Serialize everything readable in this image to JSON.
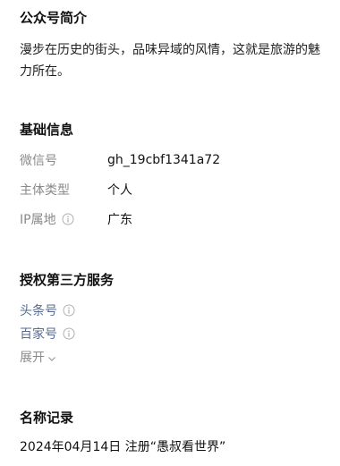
{
  "intro": {
    "title": "公众号简介",
    "description": "漫步在历史的街头，品味异域的风情，这就是旅游的魅力所在。"
  },
  "basic_info": {
    "title": "基础信息",
    "rows": [
      {
        "label": "微信号",
        "value": "gh_19cbf1341a72"
      },
      {
        "label": "主体类型",
        "value": "个人"
      },
      {
        "label": "IP属地",
        "value": "广东"
      }
    ]
  },
  "auth_services": {
    "title": "授权第三方服务",
    "items": [
      {
        "label": "头条号"
      },
      {
        "label": "百家号"
      }
    ],
    "expand_label": "展开"
  },
  "name_records": {
    "title": "名称记录",
    "entries": [
      "2024年04月14日 注册“愚叔看世界”"
    ]
  },
  "colors": {
    "link": "#576b95",
    "muted": "#8a8a8a"
  }
}
